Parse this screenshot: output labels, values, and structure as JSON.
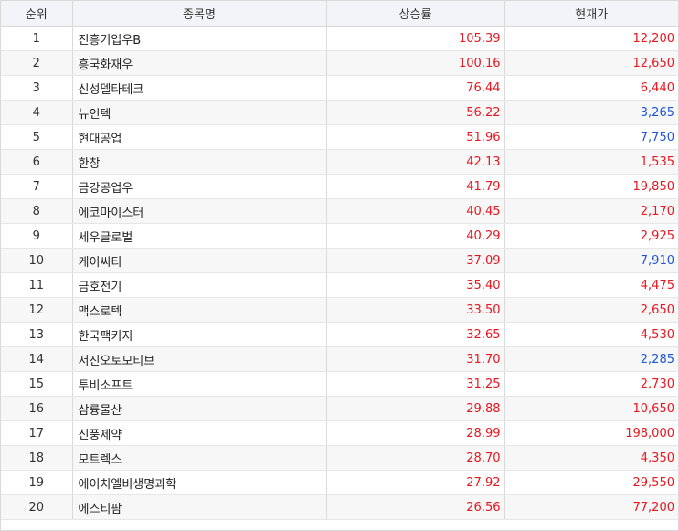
{
  "header": {
    "rank": "순위",
    "name": "종목명",
    "rate": "상승률",
    "price": "현재가"
  },
  "colors": {
    "up": "#e8161f",
    "down": "#1e56d6",
    "header_bg": "#f2f4f8",
    "stripe_bg": "#f7f7f7"
  },
  "rows": [
    {
      "rank": "1",
      "name": "진흥기업우B",
      "rate": "105.39",
      "price": "12,200",
      "price_dir": "up"
    },
    {
      "rank": "2",
      "name": "흥국화재우",
      "rate": "100.16",
      "price": "12,650",
      "price_dir": "up"
    },
    {
      "rank": "3",
      "name": "신성델타테크",
      "rate": "76.44",
      "price": "6,440",
      "price_dir": "up"
    },
    {
      "rank": "4",
      "name": "뉴인텍",
      "rate": "56.22",
      "price": "3,265",
      "price_dir": "down"
    },
    {
      "rank": "5",
      "name": "현대공업",
      "rate": "51.96",
      "price": "7,750",
      "price_dir": "down"
    },
    {
      "rank": "6",
      "name": "한창",
      "rate": "42.13",
      "price": "1,535",
      "price_dir": "up"
    },
    {
      "rank": "7",
      "name": "금강공업우",
      "rate": "41.79",
      "price": "19,850",
      "price_dir": "up"
    },
    {
      "rank": "8",
      "name": "에코마이스터",
      "rate": "40.45",
      "price": "2,170",
      "price_dir": "up"
    },
    {
      "rank": "9",
      "name": "세우글로벌",
      "rate": "40.29",
      "price": "2,925",
      "price_dir": "up"
    },
    {
      "rank": "10",
      "name": "케이씨티",
      "rate": "37.09",
      "price": "7,910",
      "price_dir": "down"
    },
    {
      "rank": "11",
      "name": "금호전기",
      "rate": "35.40",
      "price": "4,475",
      "price_dir": "up"
    },
    {
      "rank": "12",
      "name": "맥스로텍",
      "rate": "33.50",
      "price": "2,650",
      "price_dir": "up"
    },
    {
      "rank": "13",
      "name": "한국팩키지",
      "rate": "32.65",
      "price": "4,530",
      "price_dir": "up"
    },
    {
      "rank": "14",
      "name": "서진오토모티브",
      "rate": "31.70",
      "price": "2,285",
      "price_dir": "down"
    },
    {
      "rank": "15",
      "name": "투비소프트",
      "rate": "31.25",
      "price": "2,730",
      "price_dir": "up"
    },
    {
      "rank": "16",
      "name": "삼륭물산",
      "rate": "29.88",
      "price": "10,650",
      "price_dir": "up"
    },
    {
      "rank": "17",
      "name": "신풍제약",
      "rate": "28.99",
      "price": "198,000",
      "price_dir": "up"
    },
    {
      "rank": "18",
      "name": "모트렉스",
      "rate": "28.70",
      "price": "4,350",
      "price_dir": "up"
    },
    {
      "rank": "19",
      "name": "에이치엘비생명과학",
      "rate": "27.92",
      "price": "29,550",
      "price_dir": "up"
    },
    {
      "rank": "20",
      "name": "에스티팜",
      "rate": "26.56",
      "price": "77,200",
      "price_dir": "up"
    }
  ]
}
